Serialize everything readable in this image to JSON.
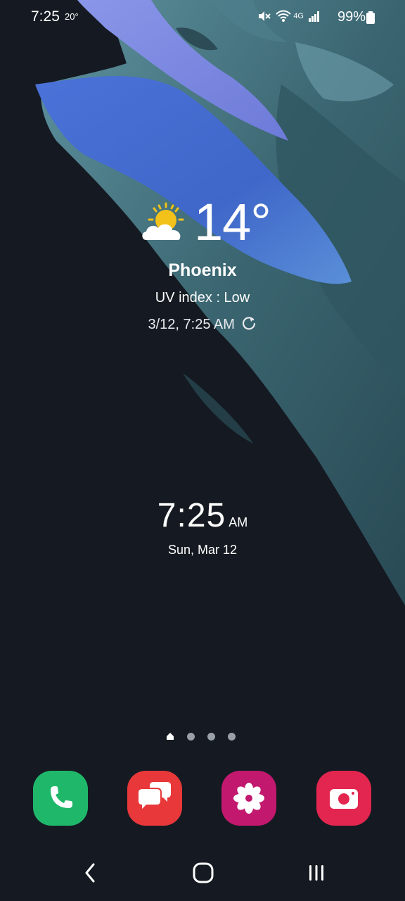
{
  "status_bar": {
    "time": "7:25",
    "temperature": "20°",
    "battery_percent": "99%",
    "icons": [
      "mute-vibrate-icon",
      "wifi-icon",
      "4g-icon",
      "signal-icon",
      "battery-icon"
    ]
  },
  "weather": {
    "temperature": "14°",
    "city": "Phoenix",
    "uv_index": "UV index : Low",
    "updated": "3/12, 7:25 AM",
    "icon": "partly-sunny-icon"
  },
  "clock": {
    "time": "7:25",
    "ampm": "AM",
    "date": "Sun, Mar 12"
  },
  "home_pages": {
    "count": 4,
    "current": 1
  },
  "dock": {
    "apps": [
      {
        "name": "Phone",
        "icon": "phone-icon",
        "color": "#1fb86a"
      },
      {
        "name": "Messages",
        "icon": "messages-icon",
        "color": "#e8383a"
      },
      {
        "name": "Blossom",
        "icon": "flower-icon",
        "color": "#c2186e"
      },
      {
        "name": "Camera",
        "icon": "camera-icon",
        "color": "#e3264f"
      }
    ]
  },
  "navigation": {
    "buttons": [
      "back-icon",
      "home-icon",
      "recents-icon"
    ]
  },
  "colors": {
    "background": "#151a22",
    "wallpaper_blue": "#3d62c4",
    "wallpaper_teal": "#3c6a74"
  }
}
